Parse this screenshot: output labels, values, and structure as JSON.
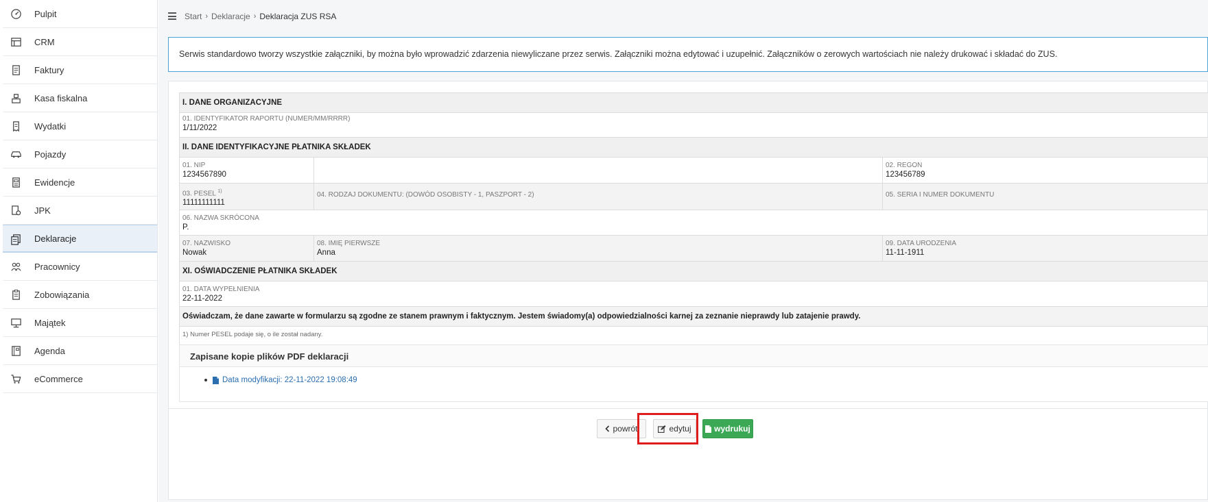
{
  "sidebar": {
    "items": [
      {
        "label": "Pulpit",
        "icon": "dashboard-icon"
      },
      {
        "label": "CRM",
        "icon": "crm-icon"
      },
      {
        "label": "Faktury",
        "icon": "invoice-icon"
      },
      {
        "label": "Kasa fiskalna",
        "icon": "cash-register-icon"
      },
      {
        "label": "Wydatki",
        "icon": "receipt-icon"
      },
      {
        "label": "Pojazdy",
        "icon": "car-icon"
      },
      {
        "label": "Ewidencje",
        "icon": "ledger-icon"
      },
      {
        "label": "JPK",
        "icon": "jpk-icon"
      },
      {
        "label": "Deklaracje",
        "icon": "declaration-icon",
        "active": true
      },
      {
        "label": "Pracownicy",
        "icon": "employees-icon"
      },
      {
        "label": "Zobowiązania",
        "icon": "liabilities-icon"
      },
      {
        "label": "Majątek",
        "icon": "assets-icon"
      },
      {
        "label": "Agenda",
        "icon": "agenda-icon"
      },
      {
        "label": "eCommerce",
        "icon": "cart-icon"
      }
    ]
  },
  "breadcrumb": {
    "start": "Start",
    "declarations": "Deklaracje",
    "current": "Deklaracja ZUS RSA"
  },
  "info": {
    "text": "Serwis standardowo tworzy wszystkie załączniki, by można było wprowadzić zdarzenia niewyliczane przez serwis. Załączniki można edytować i uzupełnić. Załączników o zerowych wartościach nie należy drukować i składać do ZUS."
  },
  "form": {
    "section1": "I. DANE ORGANIZACYJNE",
    "report_id_label": "01. IDENTYFIKATOR RAPORTU (NUMER/MM/RRRR)",
    "report_id_value": "1/11/2022",
    "section2": "II. DANE IDENTYFIKACYJNE PŁATNIKA SKŁADEK",
    "nip_label": "01. NIP",
    "nip_value": "1234567890",
    "regon_label": "02. REGON",
    "regon_value": "123456789",
    "pesel_label": "03. PESEL",
    "pesel_sup": "1)",
    "pesel_value": "11111111111",
    "doc_type_label": "04. RODZAJ DOKUMENTU: (DOWÓD OSOBISTY - 1, PASZPORT - 2)",
    "doc_series_label": "05. SERIA I NUMER DOKUMENTU",
    "short_name_label": "06. NAZWA SKRÓCONA",
    "short_name_value": "P.",
    "surname_label": "07. NAZWISKO",
    "surname_value": "Nowak",
    "firstname_label": "08. IMIĘ PIERWSZE",
    "firstname_value": "Anna",
    "birthdate_label": "09. DATA URODZENIA",
    "birthdate_value": "11-11-1911",
    "section11": "XI. OŚWIADCZENIE PŁATNIKA SKŁADEK",
    "fill_date_label": "01. DATA WYPEŁNIENIA",
    "fill_date_value": "22-11-2022",
    "declaration_text": "Oświadczam, że dane zawarte w formularzu są zgodne ze stanem prawnym i faktycznym. Jestem świadomy(a) odpowiedzialności karnej za zeznanie nieprawdy lub zatajenie prawdy.",
    "footnote": "1) Numer PESEL podaje się, o ile został nadany."
  },
  "pdf": {
    "title": "Zapisane kopie plików PDF deklaracji",
    "items": [
      {
        "label": "Data modyfikacji: 22-11-2022 19:08:49"
      }
    ]
  },
  "buttons": {
    "back": "powrót",
    "edit": "edytuj",
    "print": "wydrukuj"
  },
  "colors": {
    "accent": "#4aa3d4",
    "print_button": "#3aa855",
    "highlight": "#e01b1b",
    "link": "#2a6eb0"
  }
}
